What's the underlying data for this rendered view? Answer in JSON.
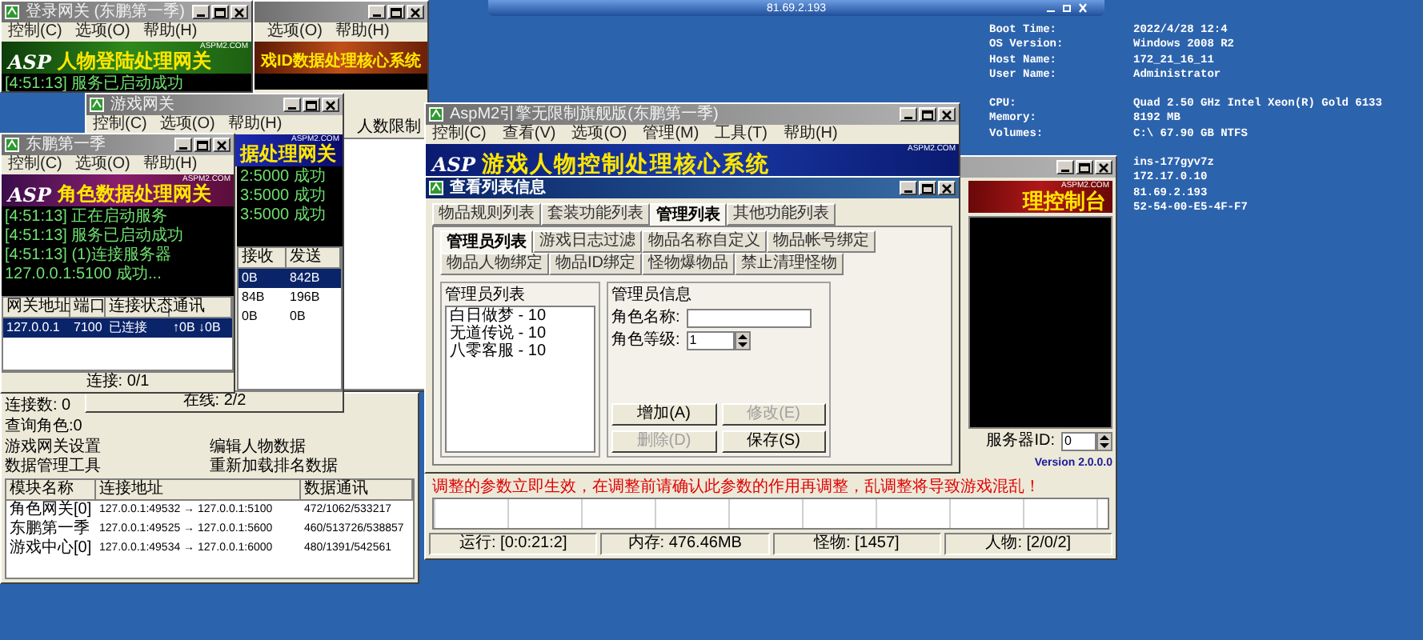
{
  "remote_bar": {
    "title": "81.69.2.193"
  },
  "system_info": {
    "groups": [
      [
        {
          "label": "Boot Time:",
          "value": "2022/4/28 12:4"
        },
        {
          "label": "OS Version:",
          "value": "Windows 2008 R2"
        },
        {
          "label": "Host Name:",
          "value": "172_21_16_11"
        },
        {
          "label": "User Name:",
          "value": "Administrator"
        }
      ],
      [
        {
          "label": "CPU:",
          "value": "Quad 2.50 GHz Intel Xeon(R) Gold 6133"
        },
        {
          "label": "Memory:",
          "value": "8192 MB"
        },
        {
          "label": "Volumes:",
          "value": "C:\\ 67.90 GB NTFS"
        }
      ]
    ],
    "network": [
      "ins-177gyv7z",
      "172.17.0.10",
      "81.69.2.193",
      "52-54-00-E5-4F-F7"
    ]
  },
  "server_window": {
    "stats": [
      "连接数: 0",
      "查询角色:0"
    ],
    "buttons": [
      "游戏网关设置",
      "编辑人物数据",
      "数据管理工具",
      "重新加载排名数据"
    ],
    "table": {
      "columns": [
        "模块名称",
        "连接地址",
        "数据通讯"
      ],
      "rows": [
        {
          "cells": [
            "角色网关[0]",
            "127.0.0.1:49532 → 127.0.0.1:5100",
            "472/1062/533217"
          ],
          "selected": false
        },
        {
          "cells": [
            "东鹏第一季",
            "127.0.0.1:49525 → 127.0.0.1:5600",
            "460/513726/538857"
          ],
          "selected": false
        },
        {
          "cells": [
            "游戏中心[0]",
            "127.0.0.1:49534 → 127.0.0.1:6000",
            "480/1391/542561"
          ],
          "selected": false
        }
      ]
    }
  },
  "db_window": {
    "active": false,
    "menu": [
      "选项(O)",
      "帮助(H)"
    ],
    "banner": {
      "text": "戏ID数据处理核心系统"
    },
    "header": "人数限制"
  },
  "login_gateway": {
    "title": "登录网关 (东鹏第一季)",
    "active": false,
    "menu": [
      "控制(C)",
      "选项(O)",
      "帮助(H)"
    ],
    "banner": {
      "logo": "ASP",
      "text": "人物登陆处理网关",
      "site": "ASPM2.COM"
    },
    "log": [
      "[4:51:13] 服务已启动成功"
    ]
  },
  "game_gateway": {
    "title": "游戏网关",
    "active": false,
    "menu": [
      "控制(C)",
      "选项(O)",
      "帮助(H)"
    ],
    "banner": {
      "text": "据处理网关",
      "site": "ASPM2.COM"
    },
    "log": [
      "2:5000 成功",
      "3:5000 成功",
      "3:5000 成功"
    ],
    "table": {
      "columns": [
        "接收",
        "发送"
      ],
      "rows": [
        {
          "cells": [
            "0B",
            "842B"
          ],
          "selected": true
        },
        {
          "cells": [
            "84B",
            "196B"
          ],
          "selected": false
        },
        {
          "cells": [
            "0B",
            "0B"
          ],
          "selected": false
        }
      ]
    },
    "status": "在线: 2/2"
  },
  "role_gateway": {
    "title": "东鹏第一季",
    "active": false,
    "menu": [
      "控制(C)",
      "选项(O)",
      "帮助(H)"
    ],
    "banner": {
      "logo": "ASP",
      "text": "角色数据处理网关",
      "site": "ASPM2.COM"
    },
    "log": [
      "[4:51:13] 正在启动服务",
      "[4:51:13] 服务已启动成功",
      "[4:51:13] (1)连接服务器 127.0.0.1:5100 成功..."
    ],
    "table": {
      "columns": [
        "网关地址",
        "端口",
        "连接状态",
        "通讯"
      ],
      "rows": [
        {
          "cells": [
            "127.0.0.1",
            "7100",
            "已连接",
            "↑0B ↓0B"
          ],
          "selected": true
        }
      ]
    },
    "status": "连接: 0/1"
  },
  "console_window": {
    "active": false,
    "banner": {
      "text": "理控制台",
      "site": "ASPM2.COM"
    },
    "server_id": {
      "label": "服务器ID:",
      "value": "0"
    },
    "version": "Version 2.0.0.0",
    "warning": "调整的参数立即生效，在调整前请确认此参数的作用再调整，乱调整将导致游戏混乱！",
    "status_bar": [
      "运行: [0:0:21:2]",
      "内存: 476.46MB",
      "怪物: [1457]",
      "人物: [2/0/2]"
    ]
  },
  "core_window": {
    "title": "AspM2引擎无限制旗舰版(东鹏第一季)",
    "active": false,
    "menu": [
      "控制(C)",
      "查看(V)",
      "选项(O)",
      "管理(M)",
      "工具(T)",
      "帮助(H)"
    ],
    "banner": {
      "logo": "ASP",
      "text": "游戏人物控制处理核心系统",
      "site": "ASPM2.COM"
    }
  },
  "list_dialog": {
    "title": "查看列表信息",
    "active": true,
    "tabs": [
      {
        "label": "物品规则列表",
        "selected": false
      },
      {
        "label": "套装功能列表",
        "selected": false
      },
      {
        "label": "管理列表",
        "selected": true
      },
      {
        "label": "其他功能列表",
        "selected": false
      }
    ],
    "subtabs": [
      {
        "label": "管理员列表",
        "selected": true
      },
      {
        "label": "游戏日志过滤",
        "selected": false
      },
      {
        "label": "物品名称自定义",
        "selected": false
      },
      {
        "label": "物品帐号绑定",
        "selected": false
      },
      {
        "label": "物品人物绑定",
        "selected": false
      },
      {
        "label": "物品ID绑定",
        "selected": false
      },
      {
        "label": "怪物爆物品",
        "selected": false
      },
      {
        "label": "禁止清理怪物",
        "selected": false
      }
    ],
    "admin_list": {
      "title": "管理员列表",
      "items": [
        "白日做梦 - 10",
        "无道传说 - 10",
        "八零客服 - 10"
      ]
    },
    "admin_info": {
      "title": "管理员信息",
      "fields": [
        {
          "label": "角色名称:",
          "kind": "text"
        },
        {
          "label": "角色等级:",
          "kind": "spin",
          "value": "1"
        }
      ]
    },
    "buttons": [
      {
        "label": "增加(A)",
        "disabled": false
      },
      {
        "label": "修改(E)",
        "disabled": true
      },
      {
        "label": "删除(D)",
        "disabled": true
      },
      {
        "label": "保存(S)",
        "disabled": false
      }
    ]
  }
}
